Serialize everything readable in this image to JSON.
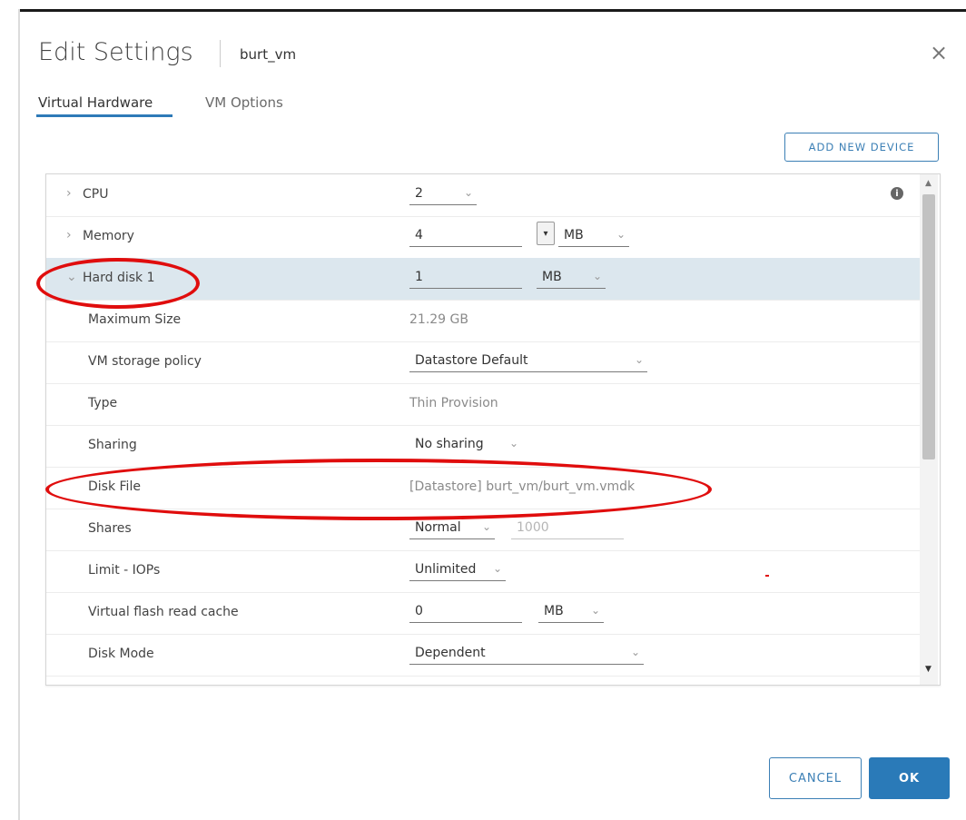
{
  "dialog": {
    "title": "Edit Settings",
    "subtitle": "burt_vm",
    "close_glyph": "×"
  },
  "tabs": [
    {
      "label": "Virtual Hardware",
      "active": true
    },
    {
      "label": "VM Options",
      "active": false
    }
  ],
  "add_device_label": "ADD NEW DEVICE",
  "rows": {
    "cpu": {
      "label": "CPU",
      "value": "2",
      "info_icon": "info-icon"
    },
    "memory": {
      "label": "Memory",
      "value": "4",
      "unit": "MB"
    },
    "hard_disk": {
      "label": "Hard disk 1",
      "value": "1",
      "unit": "MB"
    },
    "max_size": {
      "label": "Maximum Size",
      "value": "21.29 GB"
    },
    "storage_policy": {
      "label": "VM storage policy",
      "value": "Datastore Default"
    },
    "type": {
      "label": "Type",
      "value": "Thin Provision"
    },
    "sharing": {
      "label": "Sharing",
      "value": "No sharing"
    },
    "disk_file": {
      "label": "Disk File",
      "value": "[Datastore] burt_vm/burt_vm.vmdk"
    },
    "shares": {
      "label": "Shares",
      "value": "Normal",
      "amount": "1000"
    },
    "limit_iops": {
      "label": "Limit - IOPs",
      "value": "Unlimited"
    },
    "flash_cache": {
      "label": "Virtual flash read cache",
      "value": "0",
      "unit": "MB"
    },
    "disk_mode": {
      "label": "Disk Mode",
      "value": "Dependent"
    }
  },
  "buttons": {
    "cancel": "CANCEL",
    "ok": "OK"
  },
  "colors": {
    "accent": "#2a7ab8",
    "annotation": "#e00d0d",
    "selected_row": "#dce7ee"
  }
}
